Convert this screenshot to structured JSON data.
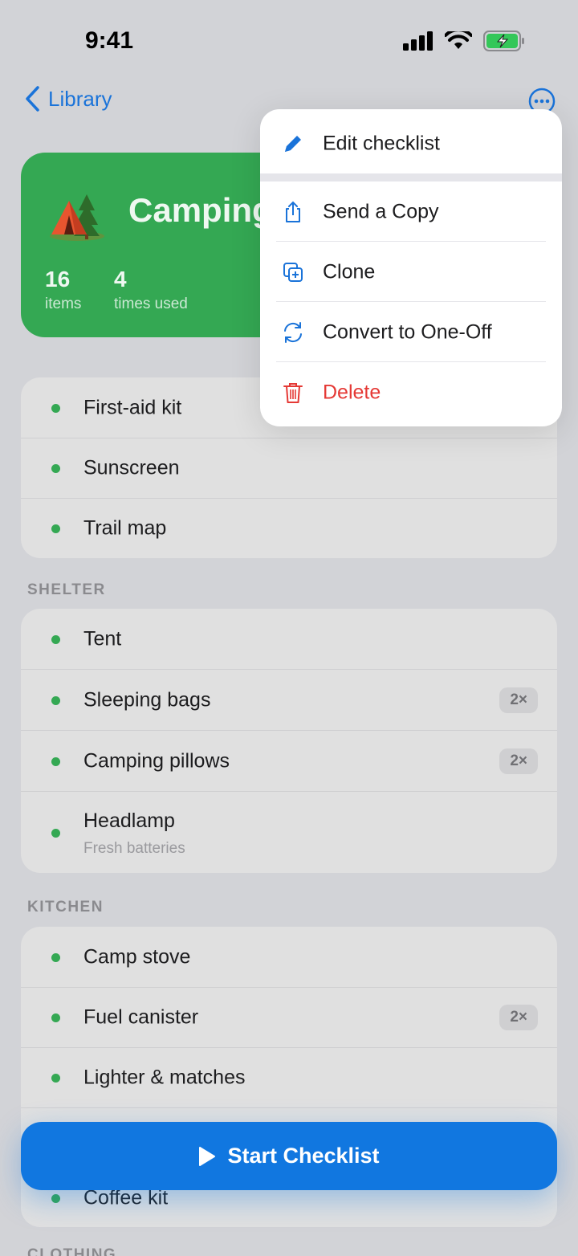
{
  "status_bar": {
    "time": "9:41"
  },
  "nav": {
    "back_label": "Library"
  },
  "header": {
    "title": "Camping",
    "emoji": "tent-icon",
    "stats": [
      {
        "value": "16",
        "label": "items"
      },
      {
        "value": "4",
        "label": "times used"
      }
    ],
    "color": "#34a853"
  },
  "groups": [
    {
      "title": "",
      "items": [
        {
          "label": "First-aid kit"
        },
        {
          "label": "Sunscreen"
        },
        {
          "label": "Trail map"
        }
      ]
    },
    {
      "title": "SHELTER",
      "items": [
        {
          "label": "Tent"
        },
        {
          "label": "Sleeping bags",
          "badge": "2×"
        },
        {
          "label": "Camping pillows",
          "badge": "2×"
        },
        {
          "label": "Headlamp",
          "note": "Fresh batteries"
        }
      ]
    },
    {
      "title": "KITCHEN",
      "items": [
        {
          "label": "Camp stove"
        },
        {
          "label": "Fuel canister",
          "badge": "2×"
        },
        {
          "label": "Lighter & matches"
        },
        {
          "label": ""
        },
        {
          "label": "Coffee kit"
        }
      ]
    },
    {
      "title": "CLOTHING"
    }
  ],
  "start_button": {
    "label": "Start Checklist"
  },
  "menu": {
    "items": [
      {
        "label": "Edit checklist",
        "icon": "pencil-icon"
      },
      {
        "label": "Send a Copy",
        "icon": "share-icon"
      },
      {
        "label": "Clone",
        "icon": "clone-icon"
      },
      {
        "label": "Convert to One-Off",
        "icon": "convert-icon"
      },
      {
        "label": "Delete",
        "icon": "trash-icon",
        "color": "#e53935"
      }
    ]
  },
  "colors": {
    "accent": "#1177e0",
    "green": "#34a853",
    "danger": "#e53935"
  }
}
